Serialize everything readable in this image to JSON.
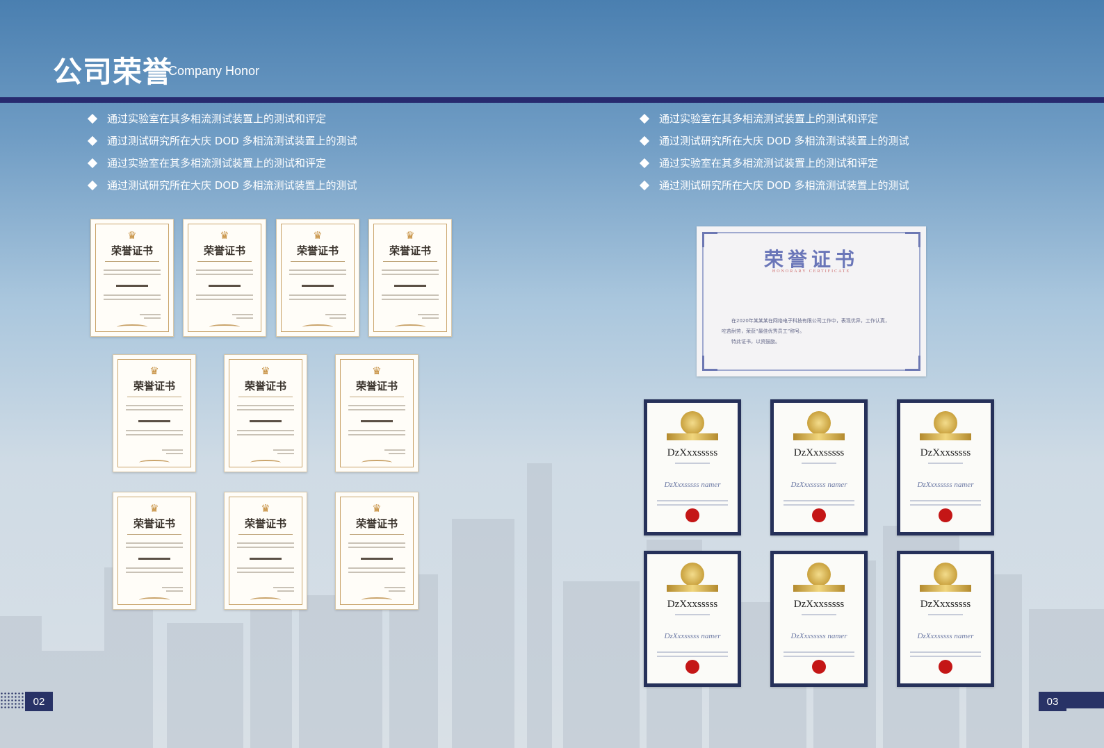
{
  "header": {
    "title_cn": "公司荣誉",
    "title_en": "Company Honor"
  },
  "left": {
    "bullets": [
      "通过实验室在其多相流测试装置上的测试和评定",
      "通过测试研究所在大庆 DOD 多相流测试装置上的测试",
      "通过实验室在其多相流测试装置上的测试和评定",
      "通过测试研究所在大庆 DOD 多相流测试装置上的测试"
    ],
    "certificate_title": "荣誉证书"
  },
  "right": {
    "bullets": [
      "通过实验室在其多相流测试装置上的测试和评定",
      "通过测试研究所在大庆 DOD 多相流测试装置上的测试",
      "通过实验室在其多相流测试装置上的测试和评定",
      "通过测试研究所在大庆 DOD 多相流测试装置上的测试"
    ],
    "big_certificate": {
      "title": "荣誉证书",
      "subtitle": "HONORARY CERTIFICATE",
      "body_line1": "在2020年某某某在网络电子科技有限公司工作中，表现优异，工作认真，",
      "body_line2": "吃苦耐劳，荣获“最佳优秀员工”称号。",
      "body_line3": "特此证书，以资鼓励。"
    },
    "navy_certificate_name": "DzXxxsssss",
    "navy_certificate_signature": "DzXxxsssss namer"
  },
  "footer": {
    "left_page": "02",
    "right_page": "03"
  },
  "colors": {
    "accent_navy": "#272a6f",
    "sky_top": "#4a7fb0",
    "seal_red": "#c41616",
    "gold": "#c9a13d"
  }
}
